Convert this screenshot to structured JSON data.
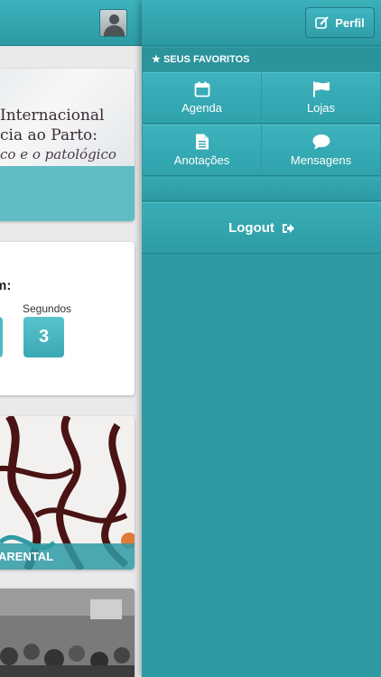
{
  "main": {
    "banner": {
      "line1": "Internacional",
      "line2": "cia ao Parto:",
      "line3": "co e o patológico"
    },
    "countdown": {
      "title": "m:",
      "partial_label": "s",
      "seconds_label": "Segundos",
      "seconds_value": "3"
    },
    "art_card": {
      "label": "ARENTAL"
    }
  },
  "menu": {
    "profile_button": "Perfil",
    "favorites_header": "SEUS FAVORITOS",
    "tiles": [
      {
        "label": "Agenda",
        "icon": "calendar-icon"
      },
      {
        "label": "Lojas",
        "icon": "flag-icon"
      },
      {
        "label": "Anotações",
        "icon": "document-icon"
      },
      {
        "label": "Mensagens",
        "icon": "chat-bubble-icon"
      }
    ],
    "logout_label": "Logout"
  },
  "colors": {
    "teal": "#2e9aa3",
    "teal_light": "#3eb3bd",
    "countdown_box": "#4dbac5"
  }
}
